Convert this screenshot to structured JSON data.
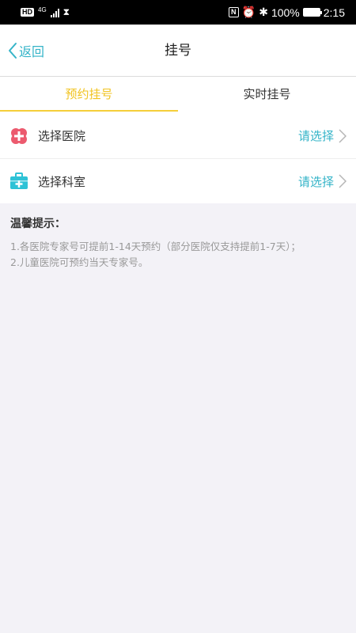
{
  "status_bar": {
    "hd": "HD",
    "network": "4G",
    "battery_percent": "100%",
    "time": "2:15",
    "icons": [
      "hd-icon",
      "signal-icon",
      "hourglass-icon",
      "nfc-icon",
      "alarm-icon",
      "bluetooth-icon",
      "battery-icon"
    ]
  },
  "header": {
    "back_label": "返回",
    "title": "挂号"
  },
  "tabs": [
    {
      "label": "预约挂号",
      "active": true
    },
    {
      "label": "实时挂号",
      "active": false
    }
  ],
  "list": [
    {
      "label": "选择医院",
      "value": "请选择",
      "icon": "hospital-icon",
      "icon_color": "#ec5a6e"
    },
    {
      "label": "选择科室",
      "value": "请选择",
      "icon": "medical-kit-icon",
      "icon_color": "#2ec2d6"
    }
  ],
  "tips": {
    "title": "温馨提示：",
    "lines": [
      "1.各医院专家号可提前1-14天预约（部分医院仅支持提前1-7天）；",
      "2.儿童医院可预约当天专家号。"
    ]
  },
  "colors": {
    "accent": "#35b4c8",
    "tab_active": "#f1c31f",
    "background": "#f3f2f7"
  }
}
